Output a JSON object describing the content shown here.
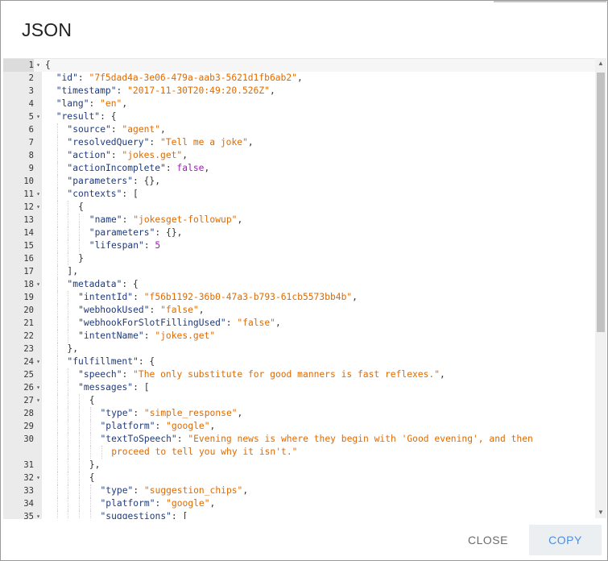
{
  "dialog": {
    "title": "JSON",
    "close_label": "CLOSE",
    "copy_label": "COPY"
  },
  "editor": {
    "active_line": 1,
    "lines": [
      {
        "n": "1",
        "fold": true,
        "tokens": [
          [
            "p",
            "{"
          ]
        ]
      },
      {
        "n": "2",
        "indent": 1,
        "tokens": [
          [
            "k",
            "\"id\""
          ],
          [
            "p",
            ": "
          ],
          [
            "s",
            "\"7f5dad4a-3e06-479a-aab3-5621d1fb6ab2\""
          ],
          [
            "p",
            ","
          ]
        ]
      },
      {
        "n": "3",
        "indent": 1,
        "tokens": [
          [
            "k",
            "\"timestamp\""
          ],
          [
            "p",
            ": "
          ],
          [
            "s",
            "\"2017-11-30T20:49:20.526Z\""
          ],
          [
            "p",
            ","
          ]
        ]
      },
      {
        "n": "4",
        "indent": 1,
        "tokens": [
          [
            "k",
            "\"lang\""
          ],
          [
            "p",
            ": "
          ],
          [
            "s",
            "\"en\""
          ],
          [
            "p",
            ","
          ]
        ]
      },
      {
        "n": "5",
        "fold": true,
        "indent": 1,
        "tokens": [
          [
            "k",
            "\"result\""
          ],
          [
            "p",
            ": {"
          ]
        ]
      },
      {
        "n": "6",
        "indent": 2,
        "tokens": [
          [
            "k",
            "\"source\""
          ],
          [
            "p",
            ": "
          ],
          [
            "s",
            "\"agent\""
          ],
          [
            "p",
            ","
          ]
        ]
      },
      {
        "n": "7",
        "indent": 2,
        "tokens": [
          [
            "k",
            "\"resolvedQuery\""
          ],
          [
            "p",
            ": "
          ],
          [
            "s",
            "\"Tell me a joke\""
          ],
          [
            "p",
            ","
          ]
        ]
      },
      {
        "n": "8",
        "indent": 2,
        "tokens": [
          [
            "k",
            "\"action\""
          ],
          [
            "p",
            ": "
          ],
          [
            "s",
            "\"jokes.get\""
          ],
          [
            "p",
            ","
          ]
        ]
      },
      {
        "n": "9",
        "indent": 2,
        "tokens": [
          [
            "k",
            "\"actionIncomplete\""
          ],
          [
            "p",
            ": "
          ],
          [
            "b",
            "false"
          ],
          [
            "p",
            ","
          ]
        ]
      },
      {
        "n": "10",
        "indent": 2,
        "tokens": [
          [
            "k",
            "\"parameters\""
          ],
          [
            "p",
            ": {},"
          ]
        ]
      },
      {
        "n": "11",
        "fold": true,
        "indent": 2,
        "tokens": [
          [
            "k",
            "\"contexts\""
          ],
          [
            "p",
            ": ["
          ]
        ]
      },
      {
        "n": "12",
        "fold": true,
        "indent": 3,
        "tokens": [
          [
            "p",
            "{"
          ]
        ]
      },
      {
        "n": "13",
        "indent": 4,
        "tokens": [
          [
            "k",
            "\"name\""
          ],
          [
            "p",
            ": "
          ],
          [
            "s",
            "\"jokesget-followup\""
          ],
          [
            "p",
            ","
          ]
        ]
      },
      {
        "n": "14",
        "indent": 4,
        "tokens": [
          [
            "k",
            "\"parameters\""
          ],
          [
            "p",
            ": {},"
          ]
        ]
      },
      {
        "n": "15",
        "indent": 4,
        "tokens": [
          [
            "k",
            "\"lifespan\""
          ],
          [
            "p",
            ": "
          ],
          [
            "n",
            "5"
          ]
        ]
      },
      {
        "n": "16",
        "indent": 3,
        "tokens": [
          [
            "p",
            "}"
          ]
        ]
      },
      {
        "n": "17",
        "indent": 2,
        "tokens": [
          [
            "p",
            "],"
          ]
        ]
      },
      {
        "n": "18",
        "fold": true,
        "indent": 2,
        "tokens": [
          [
            "k",
            "\"metadata\""
          ],
          [
            "p",
            ": {"
          ]
        ]
      },
      {
        "n": "19",
        "indent": 3,
        "tokens": [
          [
            "k",
            "\"intentId\""
          ],
          [
            "p",
            ": "
          ],
          [
            "s",
            "\"f56b1192-36b0-47a3-b793-61cb5573bb4b\""
          ],
          [
            "p",
            ","
          ]
        ]
      },
      {
        "n": "20",
        "indent": 3,
        "tokens": [
          [
            "k",
            "\"webhookUsed\""
          ],
          [
            "p",
            ": "
          ],
          [
            "s",
            "\"false\""
          ],
          [
            "p",
            ","
          ]
        ]
      },
      {
        "n": "21",
        "indent": 3,
        "tokens": [
          [
            "k",
            "\"webhookForSlotFillingUsed\""
          ],
          [
            "p",
            ": "
          ],
          [
            "s",
            "\"false\""
          ],
          [
            "p",
            ","
          ]
        ]
      },
      {
        "n": "22",
        "indent": 3,
        "tokens": [
          [
            "k",
            "\"intentName\""
          ],
          [
            "p",
            ": "
          ],
          [
            "s",
            "\"jokes.get\""
          ]
        ]
      },
      {
        "n": "23",
        "indent": 2,
        "tokens": [
          [
            "p",
            "},"
          ]
        ]
      },
      {
        "n": "24",
        "fold": true,
        "indent": 2,
        "tokens": [
          [
            "k",
            "\"fulfillment\""
          ],
          [
            "p",
            ": {"
          ]
        ]
      },
      {
        "n": "25",
        "indent": 3,
        "tokens": [
          [
            "k",
            "\"speech\""
          ],
          [
            "p",
            ": "
          ],
          [
            "s",
            "\"The only substitute for good manners is fast reflexes.\""
          ],
          [
            "p",
            ","
          ]
        ]
      },
      {
        "n": "26",
        "fold": true,
        "indent": 3,
        "tokens": [
          [
            "k",
            "\"messages\""
          ],
          [
            "p",
            ": ["
          ]
        ]
      },
      {
        "n": "27",
        "fold": true,
        "indent": 4,
        "tokens": [
          [
            "p",
            "{"
          ]
        ]
      },
      {
        "n": "28",
        "indent": 5,
        "tokens": [
          [
            "k",
            "\"type\""
          ],
          [
            "p",
            ": "
          ],
          [
            "s",
            "\"simple_response\""
          ],
          [
            "p",
            ","
          ]
        ]
      },
      {
        "n": "29",
        "indent": 5,
        "tokens": [
          [
            "k",
            "\"platform\""
          ],
          [
            "p",
            ": "
          ],
          [
            "s",
            "\"google\""
          ],
          [
            "p",
            ","
          ]
        ]
      },
      {
        "n": "30",
        "indent": 5,
        "tokens": [
          [
            "k",
            "\"textToSpeech\""
          ],
          [
            "p",
            ": "
          ],
          [
            "s",
            "\"Evening news is where they begin with 'Good evening', and then"
          ]
        ]
      },
      {
        "n": "",
        "cont": true,
        "indent": 6,
        "tokens": [
          [
            "s",
            "proceed to tell you why it isn't.\""
          ]
        ]
      },
      {
        "n": "31",
        "indent": 4,
        "tokens": [
          [
            "p",
            "},"
          ]
        ]
      },
      {
        "n": "32",
        "fold": true,
        "indent": 4,
        "tokens": [
          [
            "p",
            "{"
          ]
        ]
      },
      {
        "n": "33",
        "indent": 5,
        "tokens": [
          [
            "k",
            "\"type\""
          ],
          [
            "p",
            ": "
          ],
          [
            "s",
            "\"suggestion_chips\""
          ],
          [
            "p",
            ","
          ]
        ]
      },
      {
        "n": "34",
        "indent": 5,
        "tokens": [
          [
            "k",
            "\"platform\""
          ],
          [
            "p",
            ": "
          ],
          [
            "s",
            "\"google\""
          ],
          [
            "p",
            ","
          ]
        ]
      },
      {
        "n": "35",
        "fold": true,
        "indent": 5,
        "tokens": [
          [
            "k",
            "\"suggestions\""
          ],
          [
            "p",
            ": ["
          ]
        ]
      }
    ]
  },
  "icons": {
    "fold": "chevron-down-icon",
    "scroll_up": "arrow-up-icon",
    "scroll_down": "arrow-down-icon"
  }
}
